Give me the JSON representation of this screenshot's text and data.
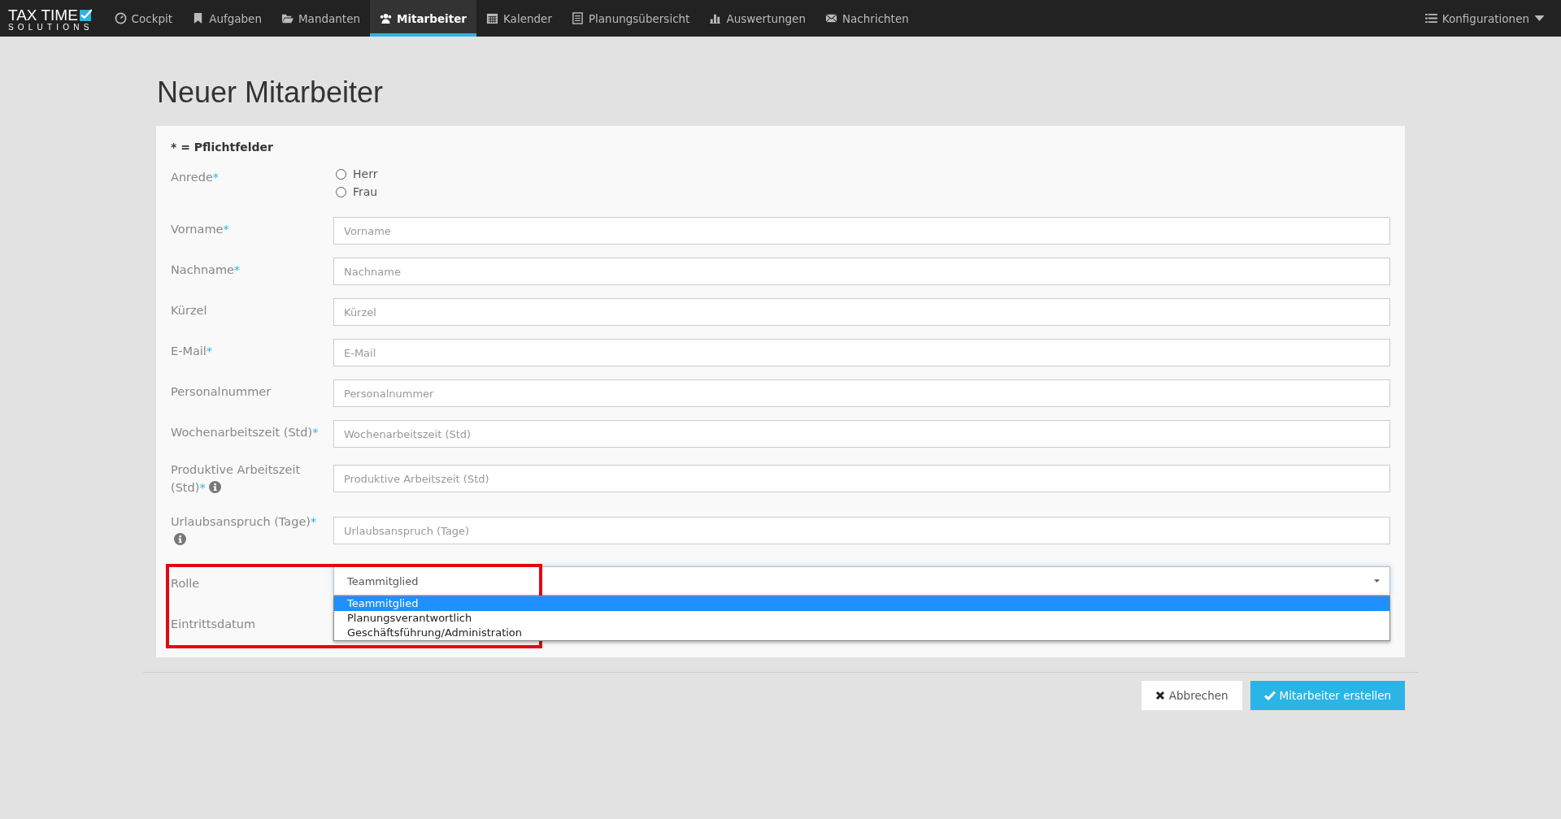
{
  "brand": {
    "line1": "TAX TIME",
    "line2": "SOLUTIONS"
  },
  "nav": [
    {
      "label": "Cockpit",
      "kind": "gauge",
      "selected": false
    },
    {
      "label": "Aufgaben",
      "kind": "bookmark",
      "selected": false
    },
    {
      "label": "Mandanten",
      "kind": "folder",
      "selected": false
    },
    {
      "label": "Mitarbeiter",
      "kind": "users",
      "selected": true
    },
    {
      "label": "Kalender",
      "kind": "calendar",
      "selected": false
    },
    {
      "label": "Planungsübersicht",
      "kind": "list",
      "selected": false
    },
    {
      "label": "Auswertungen",
      "kind": "bars",
      "selected": false
    },
    {
      "label": "Nachrichten",
      "kind": "mail",
      "selected": false
    }
  ],
  "config_menu": {
    "label": "Konfigurationen"
  },
  "page_title": "Neuer Mitarbeiter",
  "required_note": "* = Pflichtfelder",
  "fields": [
    {
      "kind": "radio",
      "label": "Anrede",
      "required_mark": "*",
      "options": [
        {
          "label": "Herr",
          "selected": false
        },
        {
          "label": "Frau",
          "selected": false
        }
      ]
    },
    {
      "kind": "text",
      "label": "Vorname",
      "required_mark": "*",
      "placeholder": "Vorname"
    },
    {
      "kind": "text",
      "label": "Nachname",
      "required_mark": "*",
      "placeholder": "Nachname"
    },
    {
      "kind": "text",
      "label": "Kürzel",
      "placeholder": "Kürzel"
    },
    {
      "kind": "text",
      "label": "E-Mail",
      "required_mark": "*",
      "placeholder": "E-Mail"
    },
    {
      "kind": "text",
      "label": "Personalnummer",
      "placeholder": "Personalnummer"
    },
    {
      "kind": "text",
      "label": "Wochenarbeitszeit (Std)",
      "required_mark": "*",
      "placeholder": "Wochenarbeitszeit (Std)"
    },
    {
      "kind": "text",
      "label": "Produktive Arbeitszeit (Std)",
      "required_mark": "*",
      "info": true,
      "placeholder": "Produktive Arbeitszeit (Std)"
    },
    {
      "kind": "text",
      "label": "Urlaubsanspruch (Tage)",
      "required_mark": "*",
      "info": true,
      "placeholder": "Urlaubsanspruch (Tage)"
    },
    {
      "kind": "select",
      "label": "Rolle",
      "value": "Teammitglied",
      "expanded": true,
      "options": [
        {
          "label": "Teammitglied",
          "selected": true
        },
        {
          "label": "Planungsverantwortlich",
          "selected": false
        },
        {
          "label": "Geschäftsführung/Administration",
          "selected": false
        }
      ]
    },
    {
      "kind": "date",
      "label": "Eintrittsdatum"
    }
  ],
  "buttons": [
    {
      "kind": "cancel",
      "label": "Abbrechen"
    },
    {
      "kind": "submit",
      "label": "Mitarbeiter erstellen"
    }
  ]
}
